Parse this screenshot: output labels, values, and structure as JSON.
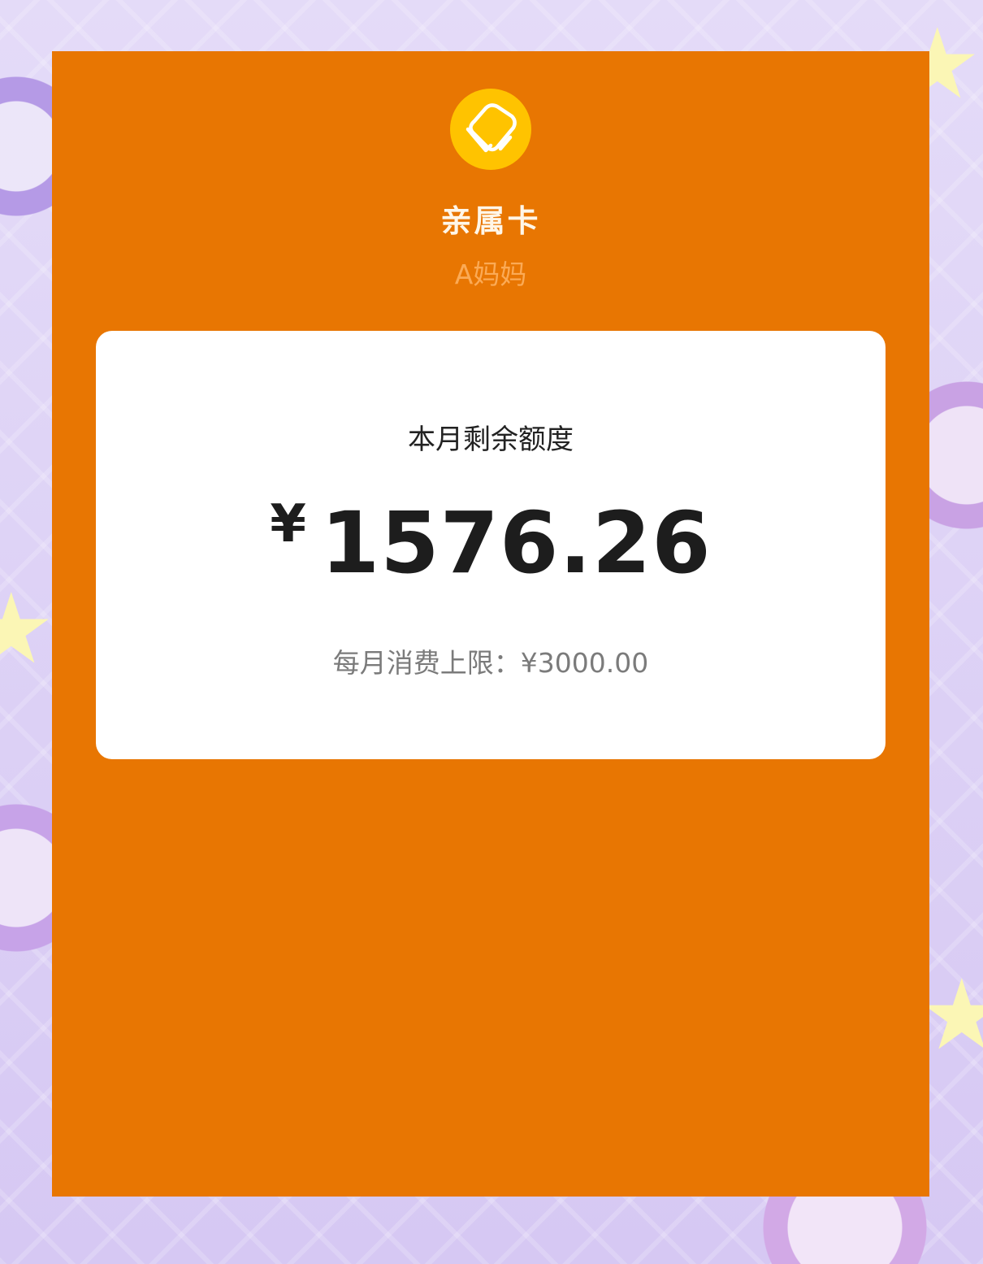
{
  "card": {
    "title": "亲属卡",
    "holder": "A妈妈",
    "logo_icon": "family-card-icon",
    "balance_label": "本月剩余额度",
    "currency_symbol": "¥",
    "balance": "1576.26",
    "limit_label": "每月消费上限：¥3000.00"
  },
  "colors": {
    "panel": "#e87602",
    "logo_bg": "#ffc300",
    "card_bg": "#ffffff",
    "background": "#d9cdf5"
  }
}
